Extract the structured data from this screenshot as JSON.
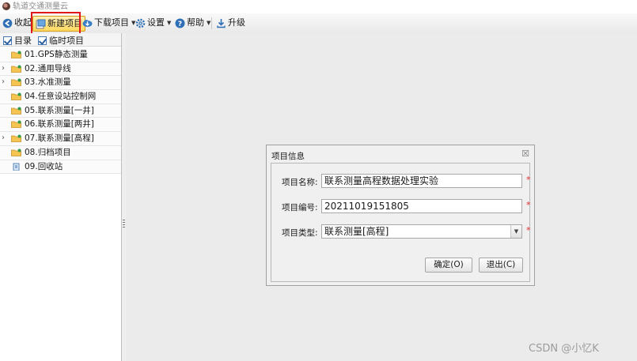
{
  "window": {
    "title": "轨道交通测量云"
  },
  "toolbar": {
    "collapse_label": "收起",
    "new_project_label": "新建项目",
    "download_label": "下载项目",
    "settings_label": "设置",
    "help_label": "帮助",
    "upgrade_label": "升级"
  },
  "sidebar": {
    "tabs": [
      {
        "label": "目录",
        "checked": true
      },
      {
        "label": "临时项目",
        "checked": true
      }
    ],
    "items": [
      {
        "label": "01.GPS静态测量",
        "icon": "folder-icon",
        "expandable": false
      },
      {
        "label": "02.通用导线",
        "icon": "folder-icon",
        "expandable": true
      },
      {
        "label": "03.水准测量",
        "icon": "folder-icon",
        "expandable": true
      },
      {
        "label": "04.任意设站控制网",
        "icon": "folder-icon",
        "expandable": false
      },
      {
        "label": "05.联系测量[一井]",
        "icon": "folder-icon",
        "expandable": false
      },
      {
        "label": "06.联系测量[两井]",
        "icon": "folder-icon",
        "expandable": false
      },
      {
        "label": "07.联系测量[高程]",
        "icon": "folder-icon",
        "expandable": true
      },
      {
        "label": "08.归档项目",
        "icon": "folder-icon",
        "expandable": false
      },
      {
        "label": "09.回收站",
        "icon": "recycle-bin-icon",
        "expandable": false
      }
    ]
  },
  "dialog": {
    "title": "项目信息",
    "close_symbol": "☒",
    "name_label": "项目名称:",
    "name_value": "联系测量高程数据处理实验",
    "number_label": "项目编号:",
    "number_value": "20211019151805",
    "type_label": "项目类型:",
    "type_value": "联系测量[高程]",
    "required_mark": "*",
    "ok_label": "确定(O)",
    "exit_label": "退出(C)"
  },
  "watermark": "CSDN @小忆K",
  "colors": {
    "highlight": "#e0171b",
    "new_project_bg": "#ffd85c",
    "required": "#e23030"
  }
}
